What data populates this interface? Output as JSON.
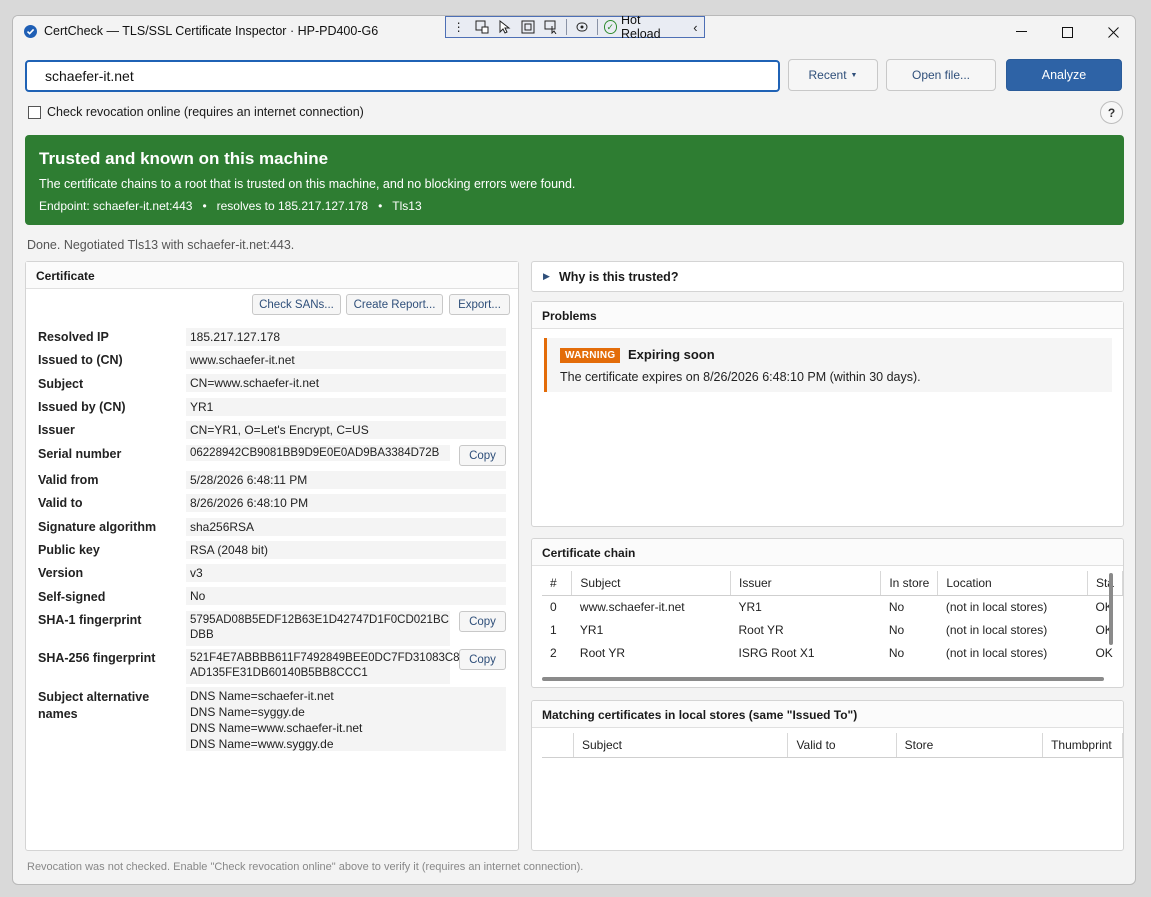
{
  "window": {
    "title": "CertCheck — TLS/SSL Certificate Inspector",
    "machine": "HP-PD400-G6",
    "hot_reload_label": "Hot Reload"
  },
  "toolbar": {
    "search_value": "schaefer-it.net",
    "recent_label": "Recent",
    "open_label": "Open file...",
    "analyze_label": "Analyze",
    "revocation_label": "Check revocation online (requires an internet connection)",
    "help_label": "?"
  },
  "banner": {
    "title": "Trusted and known on this machine",
    "description": "The certificate chains to a root that is trusted on this machine, and no blocking errors were found.",
    "endpoint": "Endpoint: schaefer-it.net:443",
    "resolves": "resolves to 185.217.127.178",
    "protocol": "Tls13",
    "color": "#2e7d32"
  },
  "status": "Done. Negotiated Tls13 with schaefer-it.net:443.",
  "certificate": {
    "header": "Certificate",
    "buttons": {
      "check_sans": "Check SANs...",
      "create_report": "Create Report...",
      "export": "Export..."
    },
    "copy_label": "Copy",
    "props": {
      "resolved_ip": {
        "label": "Resolved IP",
        "value": "185.217.127.178"
      },
      "issued_to": {
        "label": "Issued to (CN)",
        "value": "www.schaefer-it.net"
      },
      "subject": {
        "label": "Subject",
        "value": "CN=www.schaefer-it.net"
      },
      "issued_by": {
        "label": "Issued by (CN)",
        "value": "YR1"
      },
      "issuer": {
        "label": "Issuer",
        "value": "CN=YR1, O=Let's Encrypt, C=US"
      },
      "serial": {
        "label": "Serial number",
        "value": "06228942CB9081BB9D9E0E0AD9BA3384D72B"
      },
      "valid_from": {
        "label": "Valid from",
        "value": "5/28/2026 6:48:11 PM"
      },
      "valid_to": {
        "label": "Valid to",
        "value": "8/26/2026 6:48:10 PM"
      },
      "sig_alg": {
        "label": "Signature algorithm",
        "value": "sha256RSA"
      },
      "public_key": {
        "label": "Public key",
        "value": "RSA (2048 bit)"
      },
      "version": {
        "label": "Version",
        "value": "v3"
      },
      "self_signed": {
        "label": "Self-signed",
        "value": "No"
      },
      "sha1": {
        "label": "SHA-1 fingerprint",
        "line1": "5795AD08B5EDF12B63E1D42747D1F0CD021BC",
        "line2": "DBB"
      },
      "sha256": {
        "label": "SHA-256 fingerprint",
        "line1": "521F4E7ABBBB611F7492849BEE0DC7FD31083C8",
        "line2": "AD135FE31DB60140B5BB8CCC1"
      },
      "san": {
        "label1": "Subject alternative",
        "label2": "names",
        "lines": [
          "DNS Name=schaefer-it.net",
          "DNS Name=syggy.de",
          "DNS Name=www.schaefer-it.net",
          "DNS Name=www.syggy.de"
        ]
      }
    }
  },
  "why_trusted": "Why is this trusted?",
  "problems": {
    "header": "Problems",
    "items": [
      {
        "badge": "WARNING",
        "title": "Expiring soon",
        "description": "The certificate expires on 8/26/2026 6:48:10 PM (within 30 days)."
      }
    ]
  },
  "chain": {
    "header": "Certificate chain",
    "columns": [
      "#",
      "Subject",
      "Issuer",
      "In store",
      "Location",
      "Sta"
    ],
    "rows": [
      [
        "0",
        "www.schaefer-it.net",
        "YR1",
        "No",
        "(not in local stores)",
        "OK"
      ],
      [
        "1",
        "YR1",
        "Root YR",
        "No",
        "(not in local stores)",
        "OK"
      ],
      [
        "2",
        "Root YR",
        "ISRG Root X1",
        "No",
        "(not in local stores)",
        "OK"
      ]
    ]
  },
  "matching": {
    "header": "Matching certificates in local stores (same \"Issued To\")",
    "columns": [
      "",
      "Subject",
      "Valid to",
      "Store",
      "Thumbprint"
    ]
  },
  "footer": "Revocation was not checked. Enable \"Check revocation online\" above to verify it (requires an internet connection)."
}
